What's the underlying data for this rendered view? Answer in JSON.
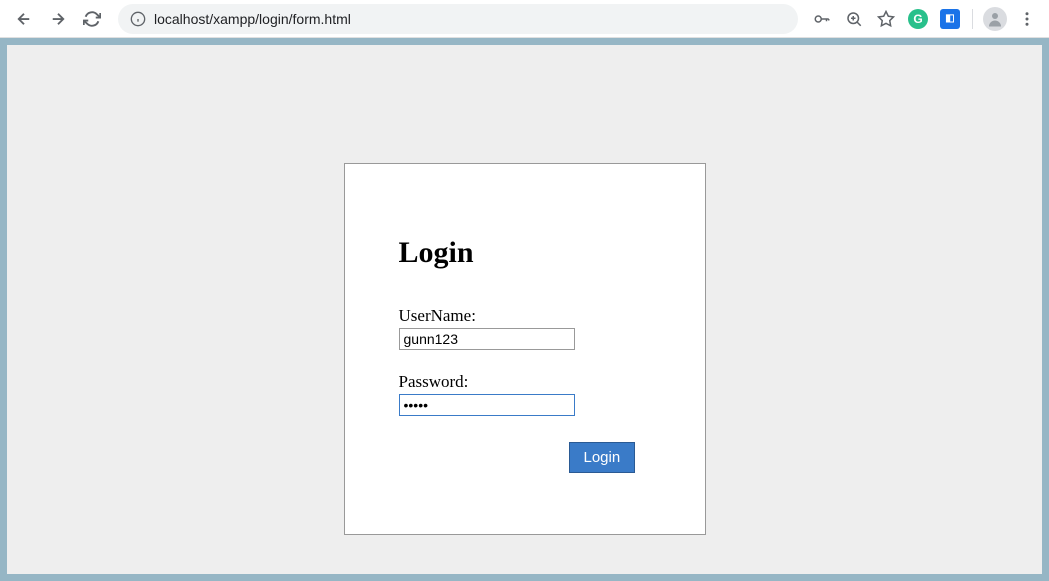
{
  "browser": {
    "url_display": "localhost/xampp/login/form.html",
    "url_host": "localhost"
  },
  "form": {
    "title": "Login",
    "username_label": "UserName:",
    "username_value": "gunn123",
    "password_label": "Password:",
    "password_value": "•••••",
    "submit_label": "Login"
  }
}
